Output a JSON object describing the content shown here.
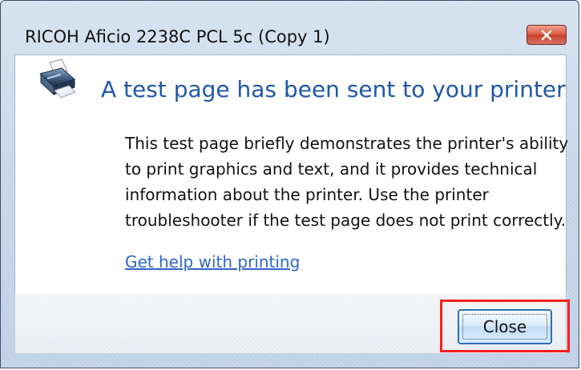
{
  "window": {
    "title": "RICOH Aficio 2238C PCL 5c (Copy 1)"
  },
  "dialog": {
    "icon": "printer-icon",
    "headline": "A test page has been sent to your printer",
    "body_lines": [
      "This test page briefly demonstrates the printer's ability",
      "to print graphics and text, and it provides technical",
      "information about the printer. Use the printer",
      "troubleshooter if the test page does not print correctly."
    ],
    "help_link": "Get help with printing"
  },
  "buttons": {
    "close_label": "Close"
  },
  "colors": {
    "headline": "#1f57a8",
    "link": "#2f66c8",
    "highlight": "#ff1e1e"
  }
}
